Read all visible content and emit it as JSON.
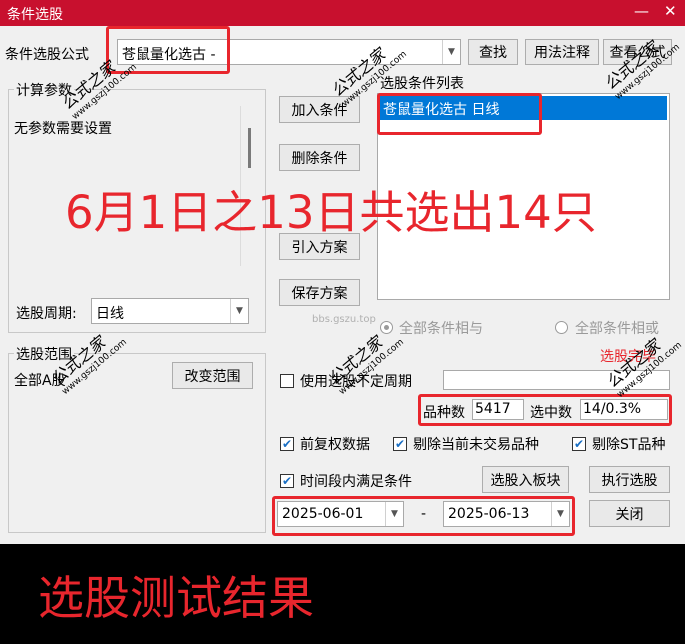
{
  "window": {
    "title": "条件选股",
    "minimize_glyph": "—",
    "close_glyph": "✕"
  },
  "formula": {
    "label": "条件选股公式",
    "value": "苍鼠量化选古 -",
    "find": "查找",
    "usage": "用法注释",
    "view": "查看公式"
  },
  "params": {
    "legend": "计算参数",
    "text": "无参数需要设置"
  },
  "period": {
    "label": "选股周期:",
    "value": "日线"
  },
  "actions": {
    "add": "加入条件",
    "remove": "删除条件",
    "import": "引入方案",
    "save": "保存方案"
  },
  "conditions": {
    "legend": "选股条件列表",
    "items": [
      "苍鼠量化选古  日线"
    ],
    "logic_and": "全部条件相与",
    "logic_or": "全部条件相或"
  },
  "scope": {
    "legend": "选股范围",
    "value": "全部A股",
    "change": "改变范围"
  },
  "options": {
    "use_period": "使用选股不定周期",
    "count_label": "品种数",
    "count_value": "5417",
    "selected_label": "选中数",
    "selected_value": "14/0.3%",
    "adjust": "前复权数据",
    "exclude_untraded": "剔除当前未交易品种",
    "exclude_st": "剔除ST品种",
    "time_range": "时间段内满足条件",
    "start_date": "2025-06-01",
    "separator": "-",
    "end_date": "2025-06-13"
  },
  "buttons": {
    "to_block": "选股入板块",
    "execute": "执行选股",
    "close": "关闭"
  },
  "overlay": {
    "headline": "6月1日之13日共选出14只",
    "banner": "选股测试结果",
    "watermark_head": "公式之家",
    "watermark_url": "www.gszj100.com",
    "faint_url": "bbs.gszu.top",
    "red_partial": "选股完毕"
  },
  "colors": {
    "accent": "#c8102e",
    "highlight_box": "#e8262d",
    "selection": "#0078d7"
  }
}
